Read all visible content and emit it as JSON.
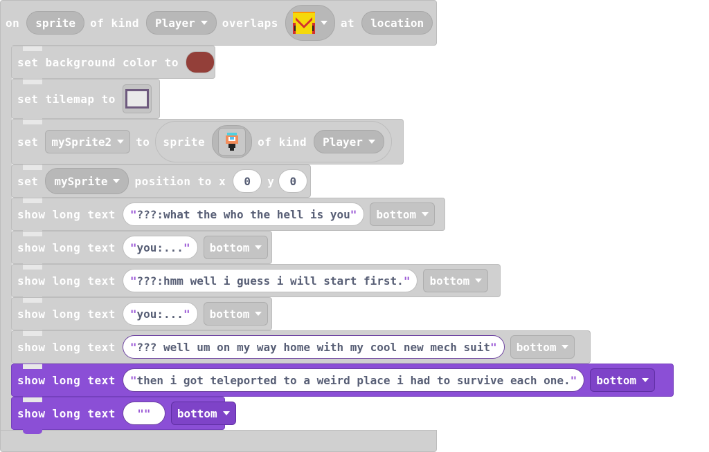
{
  "hat": {
    "on": "on",
    "sprite": "sprite",
    "of_kind": "of kind",
    "kind": "Player",
    "overlaps": "overlaps",
    "at": "at",
    "location": "location"
  },
  "bg_block": {
    "label": "set background color to",
    "color": "#933f39"
  },
  "tilemap_block": {
    "label": "set tilemap to"
  },
  "set_sprite_block": {
    "set": "set",
    "variable": "mySprite2",
    "to": "to",
    "sprite": "sprite",
    "of_kind": "of kind",
    "kind": "Player"
  },
  "position_block": {
    "set": "set",
    "variable": "mySprite",
    "position_to_x": "position to x",
    "x": "0",
    "y_label": "y",
    "y": "0"
  },
  "texts": [
    {
      "label": "show long text",
      "text": "???:what the who the hell is you",
      "position": "bottom",
      "style": "gray"
    },
    {
      "label": "show long text",
      "text": "you:...",
      "position": "bottom",
      "style": "gray"
    },
    {
      "label": "show long text",
      "text": "???:hmm well i guess i will start first.",
      "position": "bottom",
      "style": "gray"
    },
    {
      "label": "show long text",
      "text": "you:...",
      "position": "bottom",
      "style": "gray"
    },
    {
      "label": "show long text",
      "text": "??? well um on my way home with my cool new mech suit",
      "position": "bottom",
      "style": "gray"
    },
    {
      "label": "show long text",
      "text": "then i got teleported to a weird place i had to survive each one.",
      "position": "bottom",
      "style": "purple"
    },
    {
      "label": "show long text",
      "text": "",
      "position": "bottom",
      "style": "purple"
    }
  ]
}
